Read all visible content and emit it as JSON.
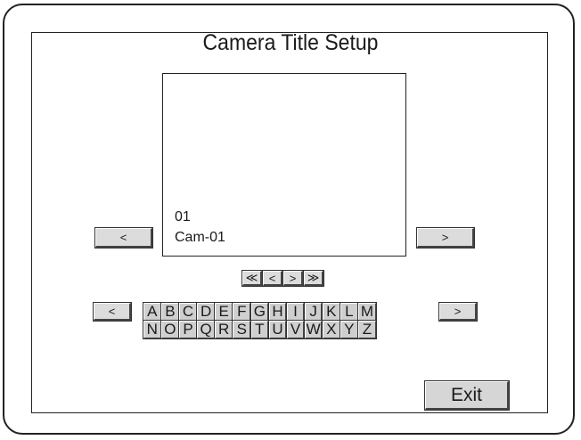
{
  "title": "Camera Title Setup",
  "preview": {
    "number": "01",
    "name": "Cam-01"
  },
  "camera_nav": {
    "prev": "<",
    "next": ">"
  },
  "cursor_keys": [
    "≪",
    "<",
    ">",
    "≫"
  ],
  "keyboard_nav": {
    "prev": "<",
    "next": ">"
  },
  "keyboard": {
    "row1": [
      "A",
      "B",
      "C",
      "D",
      "E",
      "F",
      "G",
      "H",
      "I",
      "J",
      "K",
      "L",
      "M"
    ],
    "row2": [
      "N",
      "O",
      "P",
      "Q",
      "R",
      "S",
      "T",
      "U",
      "V",
      "W",
      "X",
      "Y",
      "Z"
    ]
  },
  "exit_label": "Exit"
}
